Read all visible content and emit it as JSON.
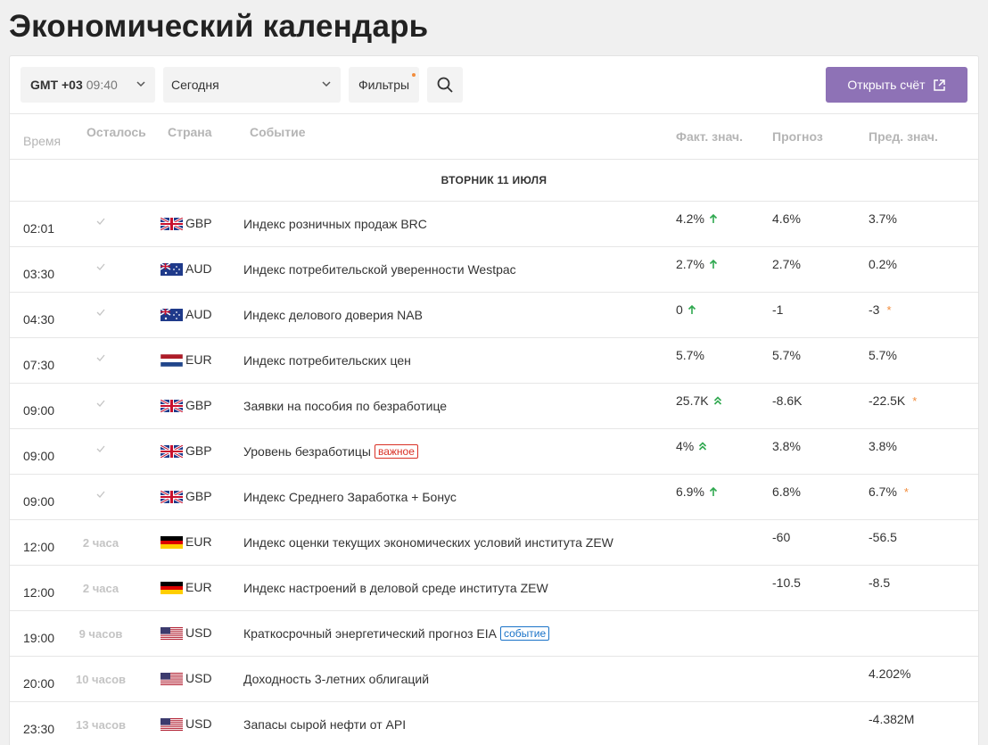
{
  "page": {
    "title": "Экономический календарь"
  },
  "toolbar": {
    "timezone_label": "GMT +03",
    "timezone_time": "09:40",
    "day_value": "Сегодня",
    "filters_label": "Фильтры",
    "open_account_label": "Открыть счёт"
  },
  "columns": {
    "time": "Время",
    "left": "Осталось",
    "country": "Страна",
    "event": "Событие",
    "actual": "Факт. знач.",
    "forecast": "Прогноз",
    "previous": "Пред. знач."
  },
  "date_header": "ВТОРНИК 11 ИЮЛЯ",
  "colors": {
    "accent": "#8e72b6",
    "up": "#2fa84f",
    "important": "#d93025",
    "event_tag": "#1a73c8",
    "revised": "#f28c3c"
  },
  "rows": [
    {
      "time": "02:01",
      "left": "",
      "done": true,
      "flag": "gb",
      "currency": "GBP",
      "event": "Индекс розничных продаж BRC",
      "tag": "",
      "actual": "4.2%",
      "trend": "up",
      "forecast": "4.6%",
      "previous": "3.7%",
      "revised": false
    },
    {
      "time": "03:30",
      "left": "",
      "done": true,
      "flag": "au",
      "currency": "AUD",
      "event": "Индекс потребительской уверенности Westpac",
      "tag": "",
      "actual": "2.7%",
      "trend": "up",
      "forecast": "2.7%",
      "previous": "0.2%",
      "revised": false
    },
    {
      "time": "04:30",
      "left": "",
      "done": true,
      "flag": "au",
      "currency": "AUD",
      "event": "Индекс делового доверия NAB",
      "tag": "",
      "actual": "0",
      "trend": "up",
      "forecast": "-1",
      "previous": "-3",
      "revised": true
    },
    {
      "time": "07:30",
      "left": "",
      "done": true,
      "flag": "nl",
      "currency": "EUR",
      "event": "Индекс потребительских цен",
      "tag": "",
      "actual": "5.7%",
      "trend": "",
      "forecast": "5.7%",
      "previous": "5.7%",
      "revised": false
    },
    {
      "time": "09:00",
      "left": "",
      "done": true,
      "flag": "gb",
      "currency": "GBP",
      "event": "Заявки на пособия по безработице",
      "tag": "",
      "actual": "25.7K",
      "trend": "double-up",
      "forecast": "-8.6K",
      "previous": "-22.5K",
      "revised": true
    },
    {
      "time": "09:00",
      "left": "",
      "done": true,
      "flag": "gb",
      "currency": "GBP",
      "event": "Уровень безработицы",
      "tag": "важное",
      "tag_type": "important",
      "actual": "4%",
      "trend": "double-up",
      "forecast": "3.8%",
      "previous": "3.8%",
      "revised": false
    },
    {
      "time": "09:00",
      "left": "",
      "done": true,
      "flag": "gb",
      "currency": "GBP",
      "event": "Индекс Среднего Заработка + Бонус",
      "tag": "",
      "actual": "6.9%",
      "trend": "up",
      "forecast": "6.8%",
      "previous": "6.7%",
      "revised": true
    },
    {
      "time": "12:00",
      "left": "2 часа",
      "done": false,
      "flag": "de",
      "currency": "EUR",
      "event": "Индекс оценки текущих экономических условий института ZEW",
      "tag": "",
      "actual": "",
      "trend": "",
      "forecast": "-60",
      "previous": "-56.5",
      "revised": false
    },
    {
      "time": "12:00",
      "left": "2 часа",
      "done": false,
      "flag": "de",
      "currency": "EUR",
      "event": "Индекс настроений в деловой среде института ZEW",
      "tag": "",
      "actual": "",
      "trend": "",
      "forecast": "-10.5",
      "previous": "-8.5",
      "revised": false
    },
    {
      "time": "19:00",
      "left": "9 часов",
      "done": false,
      "flag": "us",
      "currency": "USD",
      "event": "Краткосрочный энергетический прогноз EIA",
      "tag": "событие",
      "tag_type": "event",
      "actual": "",
      "trend": "",
      "forecast": "",
      "previous": "",
      "revised": false
    },
    {
      "time": "20:00",
      "left": "10 часов",
      "done": false,
      "flag": "us",
      "currency": "USD",
      "event": "Доходность 3-летних облигаций",
      "tag": "",
      "actual": "",
      "trend": "",
      "forecast": "",
      "previous": "4.202%",
      "revised": false
    },
    {
      "time": "23:30",
      "left": "13 часов",
      "done": false,
      "flag": "us",
      "currency": "USD",
      "event": "Запасы сырой нефти от API",
      "tag": "",
      "actual": "",
      "trend": "",
      "forecast": "",
      "previous": "-4.382M",
      "revised": false
    }
  ]
}
